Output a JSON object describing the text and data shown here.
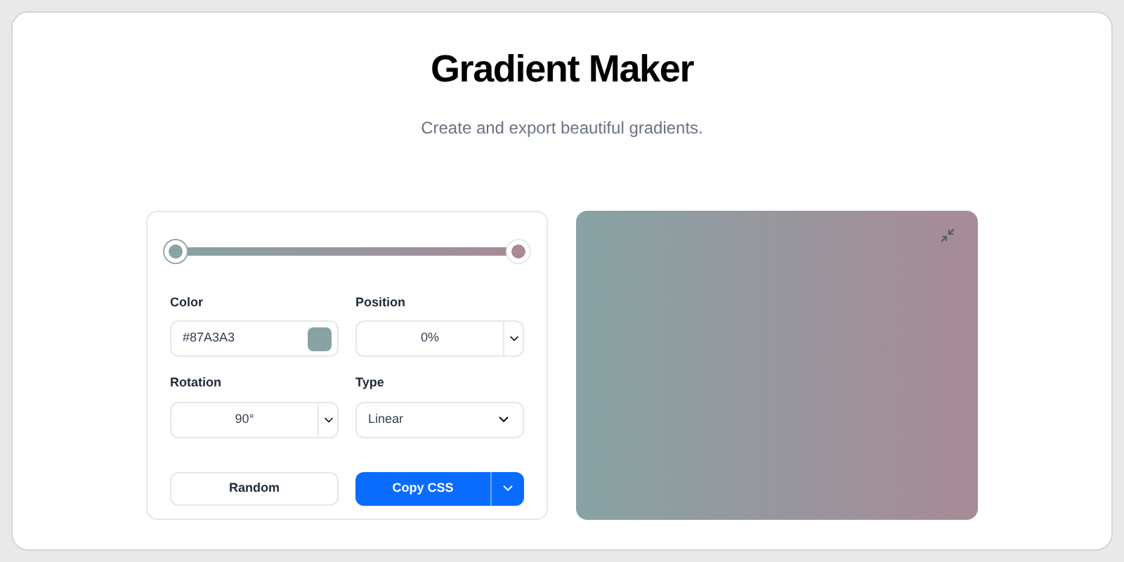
{
  "title": "Gradient Maker",
  "subtitle": "Create and export beautiful gradients.",
  "stops": [
    {
      "color": "#87a3a3",
      "selected": true
    },
    {
      "color": "#a88a97",
      "selected": false
    }
  ],
  "fields": {
    "color": {
      "label": "Color",
      "value": "#87A3A3"
    },
    "position": {
      "label": "Position",
      "value": "0%"
    },
    "rotation": {
      "label": "Rotation",
      "value": "90°"
    },
    "type": {
      "label": "Type",
      "value": "Linear"
    }
  },
  "buttons": {
    "random": "Random",
    "copy": "Copy CSS"
  }
}
